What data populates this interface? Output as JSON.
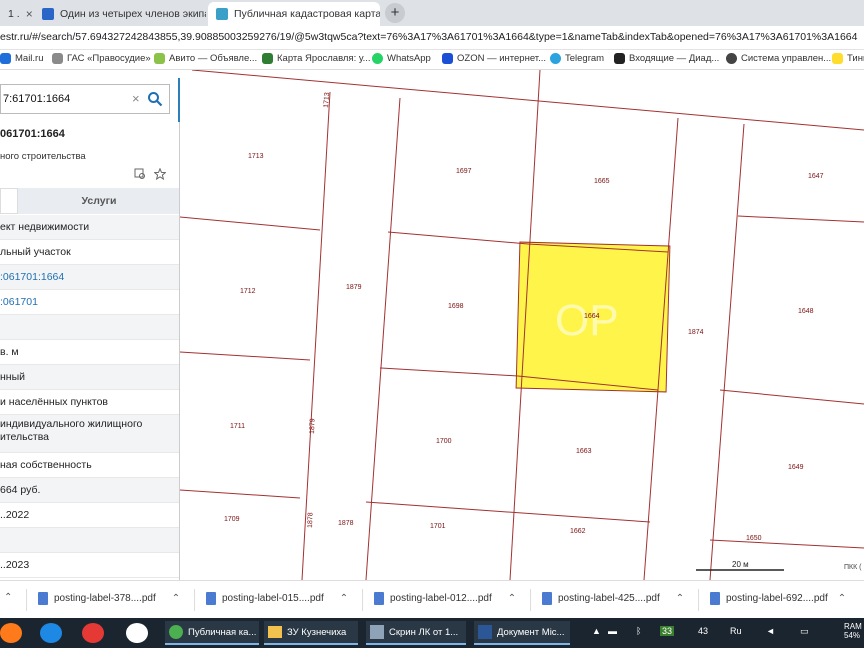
{
  "browser": {
    "tabs": [
      {
        "title": "1 .",
        "active": false
      },
      {
        "title": "Один из четырех членов экипа",
        "active": false
      },
      {
        "title": "Публичная кадастровая карта",
        "active": true
      }
    ],
    "new_tab": "+",
    "url": "estr.ru/#/search/57.694327242843855,39.90885003259276/19/@5w3tqw5ca?text=76%3A17%3A61701%3A1664&type=1&nameTab&indexTab&opened=76%3A17%3A61701%3A1664",
    "bookmarks": [
      "Mail.ru",
      "ГАС «Правосудие»",
      "Авито — Объявле...",
      "Карта Ярославля: у...",
      "WhatsApp",
      "OZON — интернет...",
      "Telegram",
      "Входящие — Диад...",
      "Система управлен...",
      "Тинь"
    ]
  },
  "panel": {
    "search_value": "7:61701:1664",
    "clear_glyph": "×",
    "collapse_glyph": "‹",
    "title": "061701:1664",
    "subtitle": "ного строительства",
    "tab_services": "Услуги",
    "rows": [
      "ект недвижимости",
      "льный участок",
      ":061701:1664",
      ":061701",
      "",
      "в. м",
      "нный",
      "и населённых пунктов",
      "индивидуального жилищного\nительства",
      "ная собственность",
      "664 руб.",
      "..2022",
      "",
      "..2023"
    ]
  },
  "map": {
    "parcel_labels": [
      "1713",
      "1697",
      "1665",
      "1647",
      "1712",
      "1879",
      "1698",
      "1664",
      "1874",
      "1648",
      "1711",
      "1879",
      "1700",
      "1663",
      "1649",
      "1709",
      "1878",
      "1878",
      "1701",
      "1662",
      "1650",
      "1713"
    ],
    "highlighted_parcel": "1664",
    "highlight_color": "#fff54a",
    "watermark": "OP",
    "scale_label": "20 м",
    "corner_text": "ПКК ("
  },
  "downloads": [
    "posting-label-378....pdf",
    "posting-label-015....pdf",
    "posting-label-012....pdf",
    "posting-label-425....pdf",
    "posting-label-692....pdf"
  ],
  "taskbar": {
    "tasks": [
      "Публичная ка...",
      "ЗУ Кузнечиха",
      "Скрин ЛК от 1...",
      "Документ Mic..."
    ],
    "tray": [
      "33",
      "43",
      "Ru",
      "RAM\n54%"
    ]
  }
}
